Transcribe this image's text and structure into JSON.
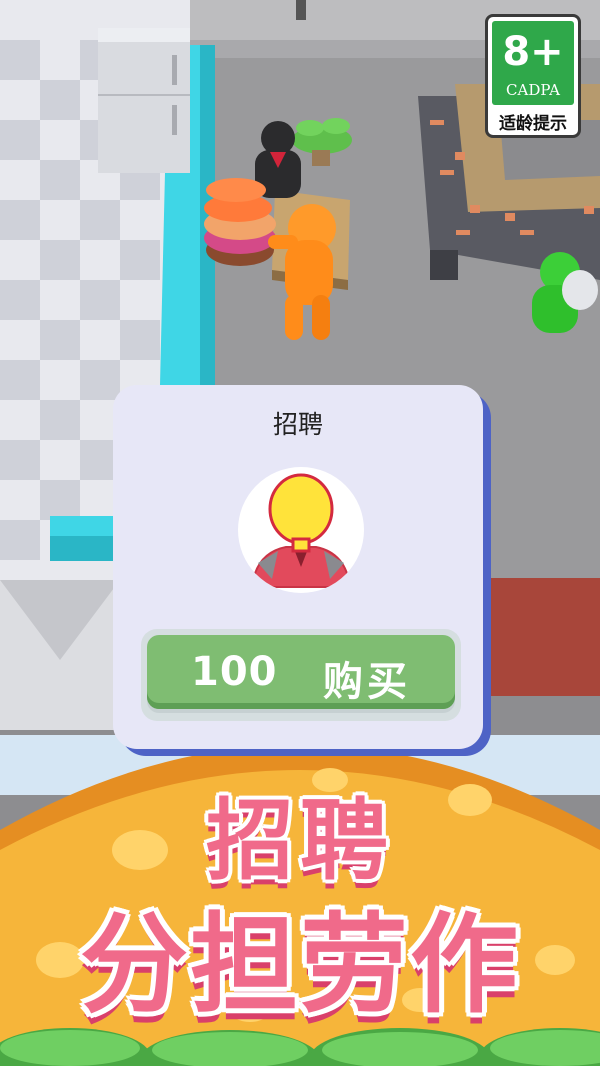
{
  "rating": {
    "age": "8+",
    "org": "CADPA",
    "tip": "适龄提示"
  },
  "dialog": {
    "title": "招聘",
    "price": "100",
    "buy_label": "购买"
  },
  "banner": {
    "title": "招聘",
    "subtitle": "分担劳作"
  },
  "colors": {
    "dialog_bg": "#e7e7f7",
    "dialog_shadow": "#4e63c6",
    "buy_button": "#7fbd72",
    "banner_text": "#f06a8a",
    "banner_bread": "#f6b53a",
    "badge_green": "#2fa84a"
  }
}
